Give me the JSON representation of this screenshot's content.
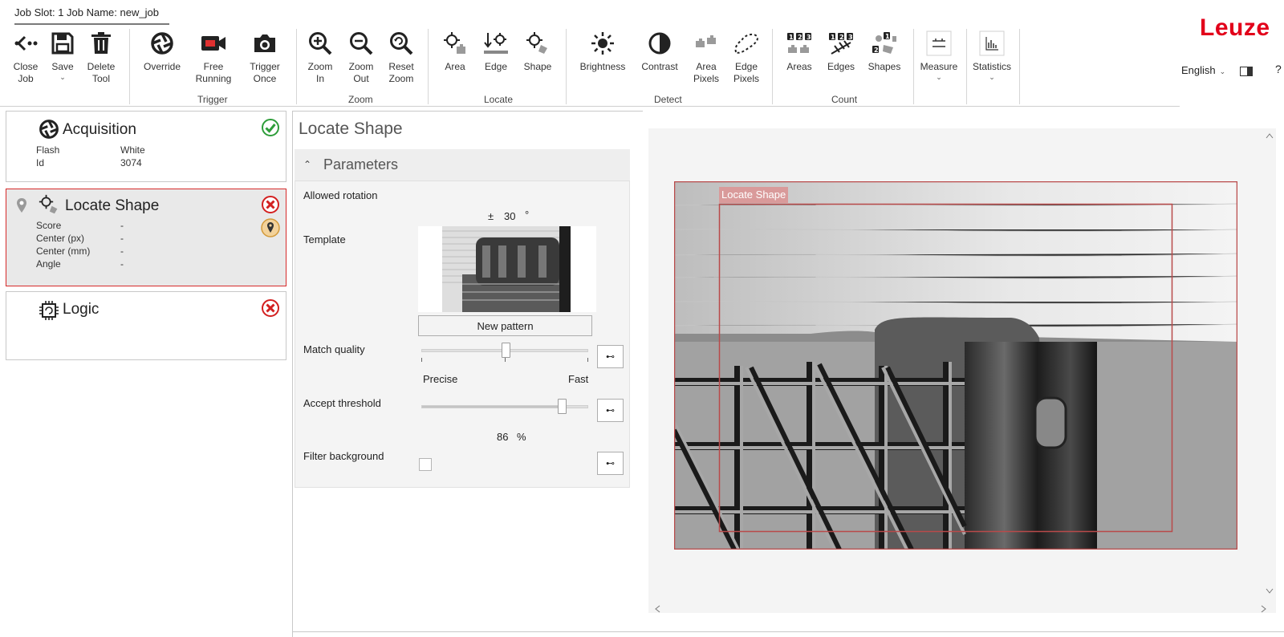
{
  "job_bar": {
    "text": "Job Slot: 1 Job Name: new_job"
  },
  "toolbar": {
    "close_job": "Close\nJob",
    "save": "Save",
    "delete_tool": "Delete\nTool",
    "override": "Override",
    "free_running": "Free\nRunning",
    "trigger_once": "Trigger\nOnce",
    "zoom_in": "Zoom\nIn",
    "zoom_out": "Zoom\nOut",
    "reset_zoom": "Reset\nZoom",
    "area": "Area",
    "edge": "Edge",
    "shape": "Shape",
    "brightness": "Brightness",
    "contrast": "Contrast",
    "area_pixels": "Area\nPixels",
    "edge_pixels": "Edge\nPixels",
    "areas": "Areas",
    "edges": "Edges",
    "shapes": "Shapes",
    "measure": "Measure",
    "statistics": "Statistics"
  },
  "groups": {
    "trigger": "Trigger",
    "zoom": "Zoom",
    "locate": "Locate",
    "detect": "Detect",
    "count": "Count"
  },
  "brand": {
    "logo": "Leuze"
  },
  "language": {
    "selected": "English"
  },
  "tools": {
    "acquisition": {
      "title": "Acquisition",
      "rows": [
        {
          "key": "Flash",
          "value": "White"
        },
        {
          "key": "Id",
          "value": "3074"
        }
      ],
      "status": "ok"
    },
    "locate_shape": {
      "title": "Locate Shape",
      "rows": [
        {
          "key": "Score",
          "value": "-"
        },
        {
          "key": "Center (px)",
          "value": "-"
        },
        {
          "key": "Center (mm)",
          "value": "-"
        },
        {
          "key": "Angle",
          "value": "-"
        }
      ],
      "status": "fail"
    },
    "logic": {
      "title": "Logic",
      "status": "fail"
    }
  },
  "panel": {
    "title": "Locate Shape",
    "section": "Parameters",
    "allowed_rotation_label": "Allowed rotation",
    "rotation_pm": "±",
    "rotation_value": "30",
    "rotation_unit": "°",
    "template_label": "Template",
    "new_pattern": "New pattern",
    "match_quality_label": "Match quality",
    "match_quality_level": 0.5,
    "precise": "Precise",
    "fast": "Fast",
    "accept_threshold_label": "Accept threshold",
    "accept_threshold_value": "86",
    "accept_threshold_unit": "%",
    "filter_background_label": "Filter background",
    "filter_background_checked": false
  },
  "view": {
    "roi_label": "Locate Shape"
  },
  "colors": {
    "brand_red": "#e2001a",
    "roi": "#b94a4a",
    "ok_green": "#2e9d3a",
    "fail_red": "#d32020"
  }
}
